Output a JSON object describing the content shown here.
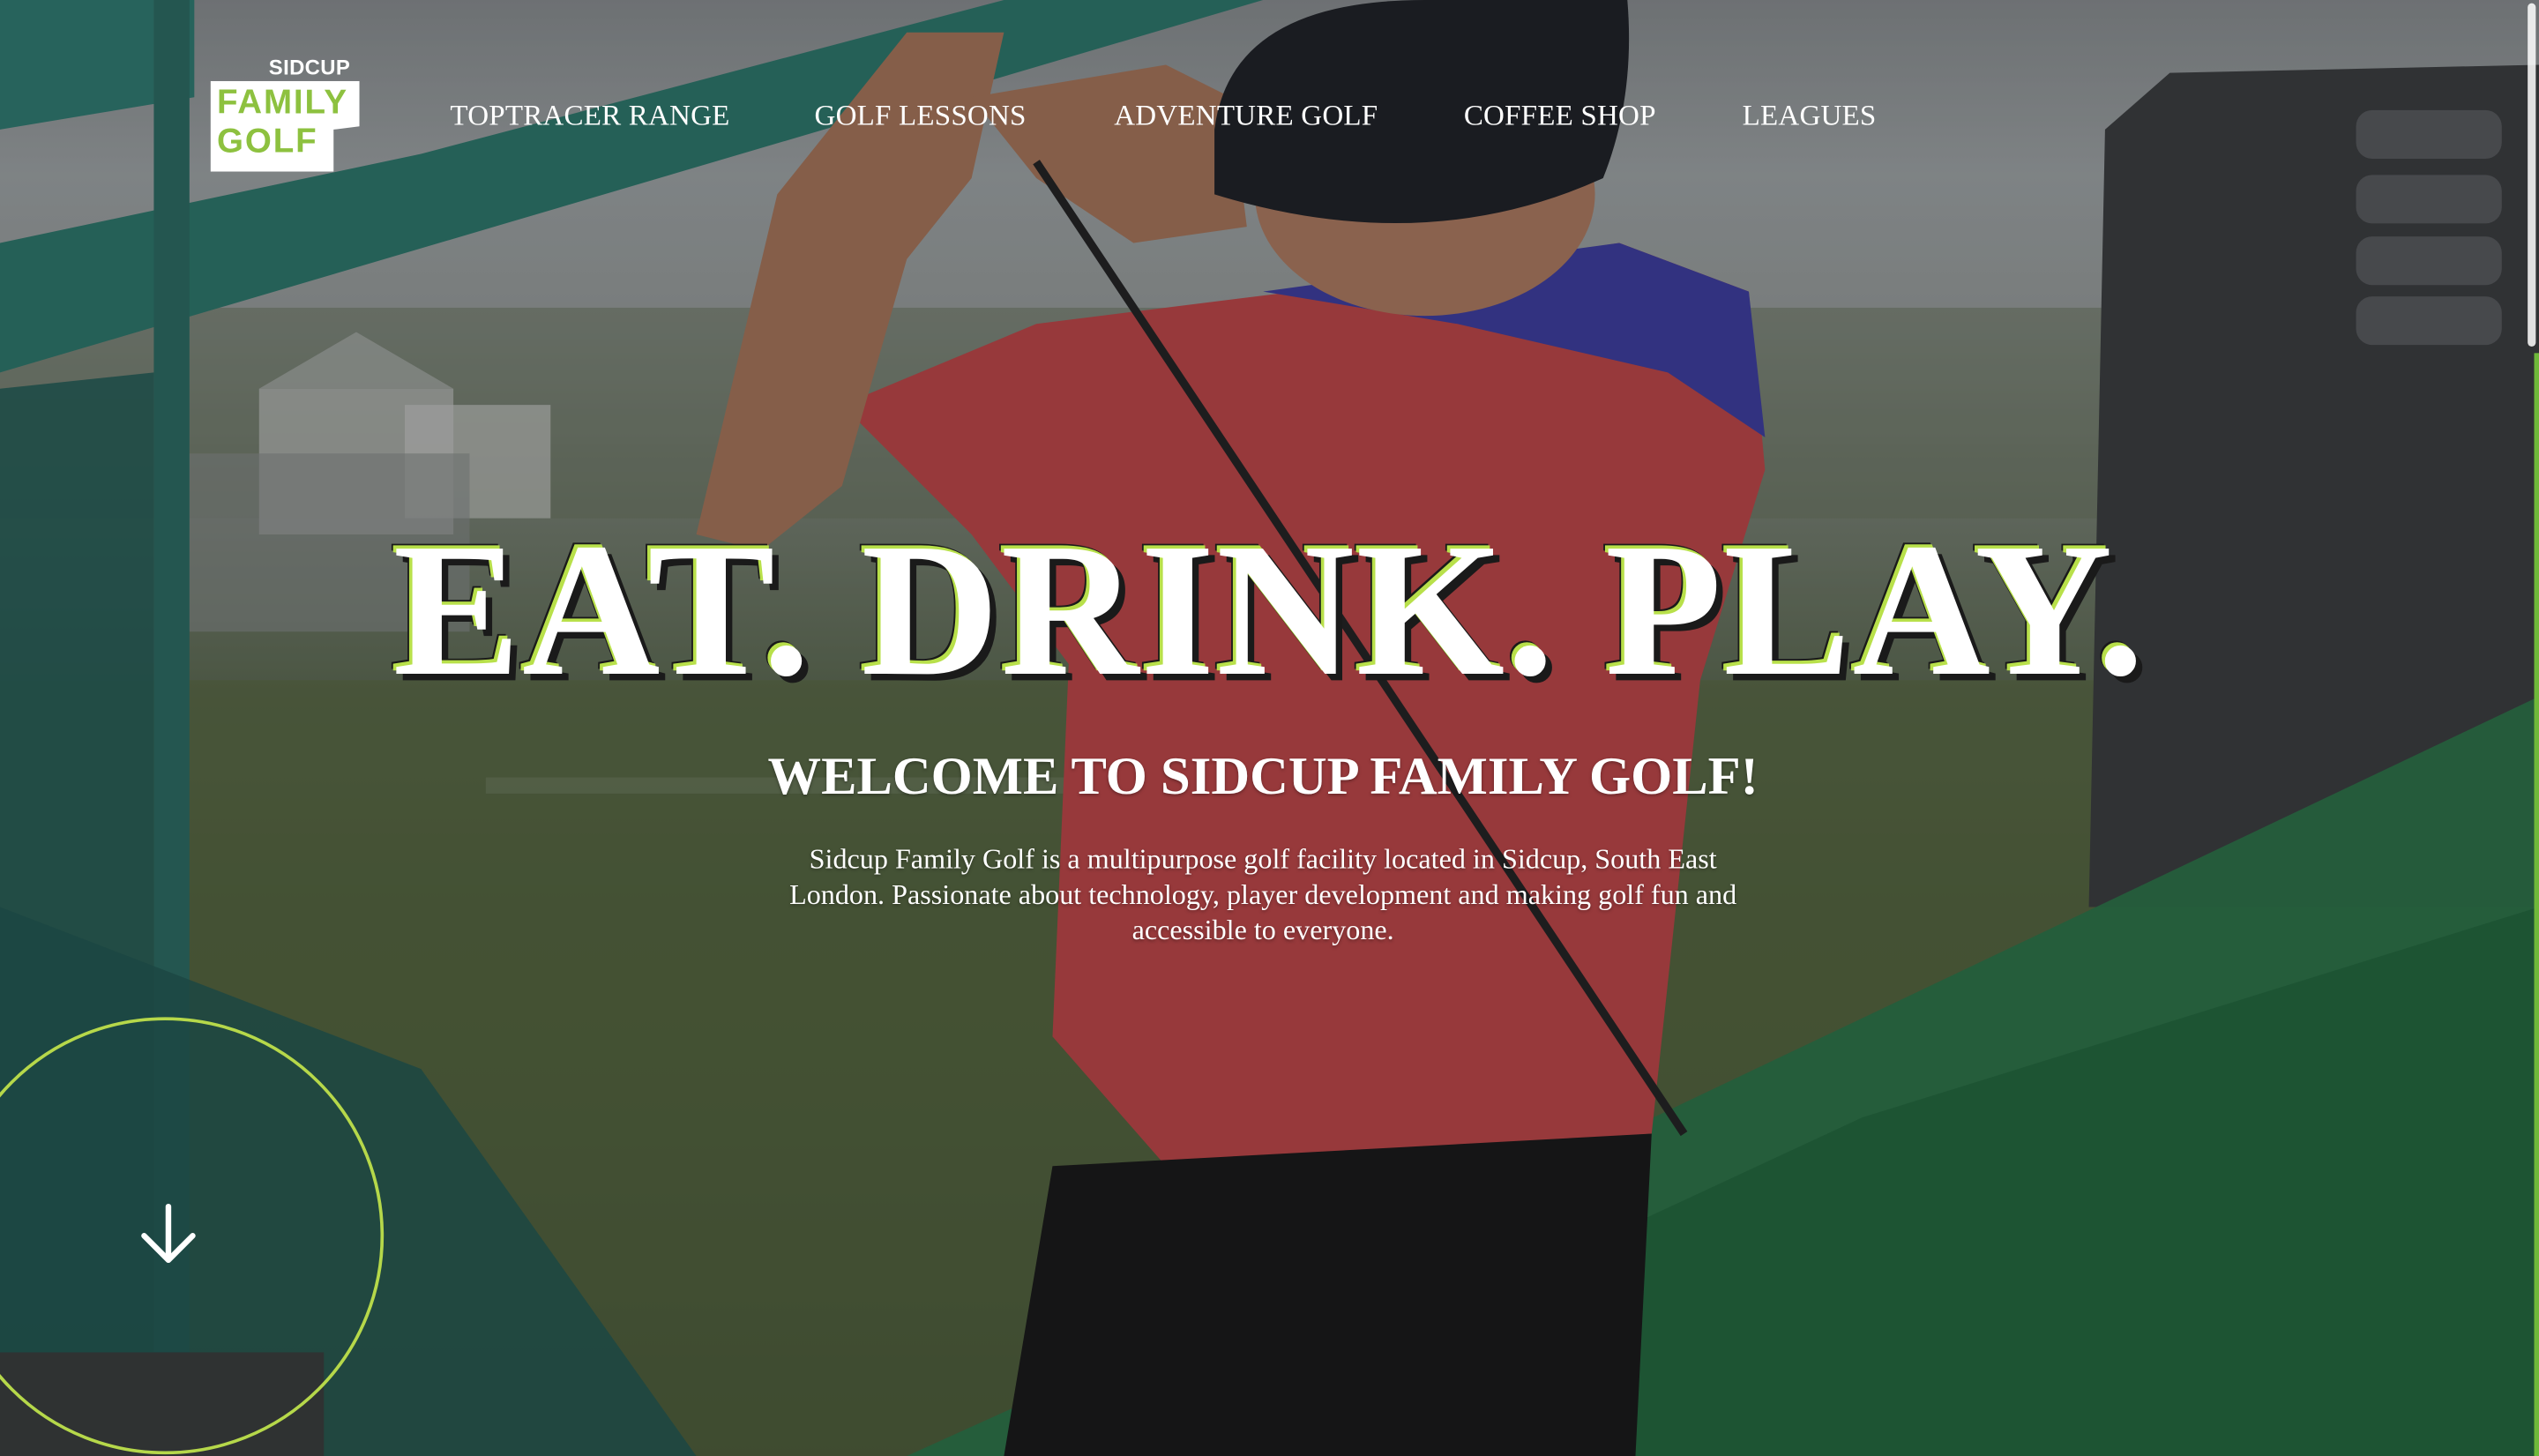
{
  "brand": {
    "logo_top": "SIDCUP",
    "logo_line1": "FAMILY",
    "logo_line2": "GOLF",
    "accent_color": "#8dc13f"
  },
  "nav": {
    "items": [
      {
        "label": "TOPTRACER RANGE"
      },
      {
        "label": "GOLF LESSONS"
      },
      {
        "label": "ADVENTURE GOLF"
      },
      {
        "label": "COFFEE SHOP"
      },
      {
        "label": "LEAGUES"
      }
    ]
  },
  "hero": {
    "headline": "EAT. DRINK. PLAY.",
    "welcome": "WELCOME TO SIDCUP FAMILY GOLF!",
    "intro": "Sidcup Family Golf is a multipurpose golf facility located in Sidcup, South East London. Passionate about technology, player development and making golf fun and accessible to everyone.",
    "scroll_icon": "arrow-down-icon"
  }
}
